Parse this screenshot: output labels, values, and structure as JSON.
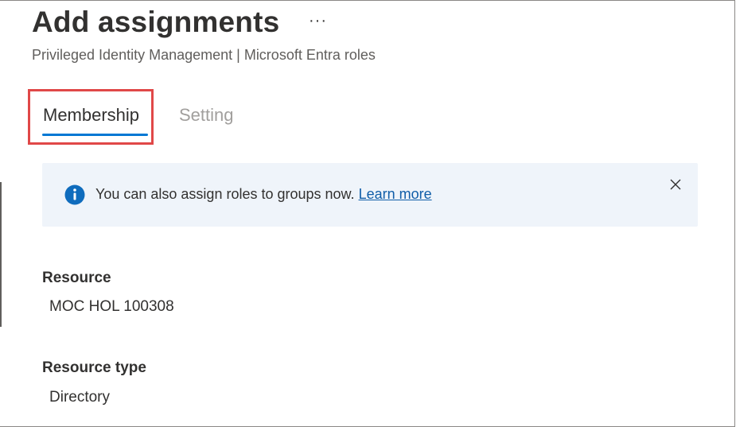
{
  "header": {
    "title": "Add assignments",
    "more_label": "···",
    "subtitle": "Privileged Identity Management | Microsoft Entra roles"
  },
  "tabs": [
    {
      "label": "Membership",
      "active": true
    },
    {
      "label": "Setting",
      "active": false
    }
  ],
  "banner": {
    "text": "You can also assign roles to groups now.",
    "link_label": "Learn more",
    "icon": "info-icon",
    "close_icon": "close-icon"
  },
  "fields": [
    {
      "label": "Resource",
      "value": "MOC HOL 100308"
    },
    {
      "label": "Resource type",
      "value": "Directory"
    }
  ],
  "colors": {
    "accent": "#0078d4",
    "highlight": "#e04848",
    "banner_bg": "#eff4fa",
    "link": "#0f5da8"
  }
}
